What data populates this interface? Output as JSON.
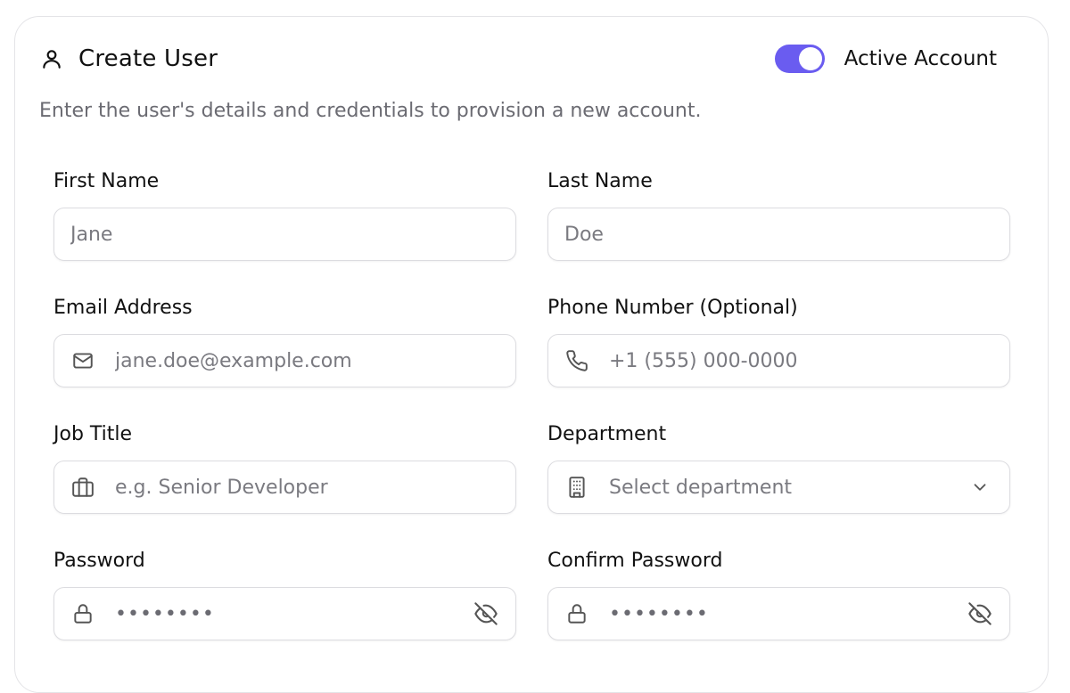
{
  "header": {
    "title": "Create User",
    "title_icon": "user-icon",
    "subtitle": "Enter the user's details and credentials to provision a new account.",
    "active_toggle": {
      "label": "Active Account",
      "on": true,
      "color": "#6a5cf0"
    }
  },
  "fields": {
    "first_name": {
      "label": "First Name",
      "placeholder": "Jane"
    },
    "last_name": {
      "label": "Last Name",
      "placeholder": "Doe"
    },
    "email": {
      "label": "Email Address",
      "placeholder": "jane.doe@example.com",
      "icon": "mail-icon"
    },
    "phone": {
      "label": "Phone Number (Optional)",
      "placeholder": "+1 (555) 000-0000",
      "icon": "phone-icon"
    },
    "job_title": {
      "label": "Job Title",
      "placeholder": "e.g. Senior Developer",
      "icon": "briefcase-icon"
    },
    "department": {
      "label": "Department",
      "selected": "Select department",
      "icon": "building-icon",
      "trailing_icon": "chevron-down-icon"
    },
    "password": {
      "label": "Password",
      "value": "••••••••",
      "icon": "lock-icon",
      "trailing_icon": "eye-off-icon"
    },
    "confirm_password": {
      "label": "Confirm Password",
      "value": "••••••••",
      "icon": "lock-icon",
      "trailing_icon": "eye-off-icon"
    }
  }
}
